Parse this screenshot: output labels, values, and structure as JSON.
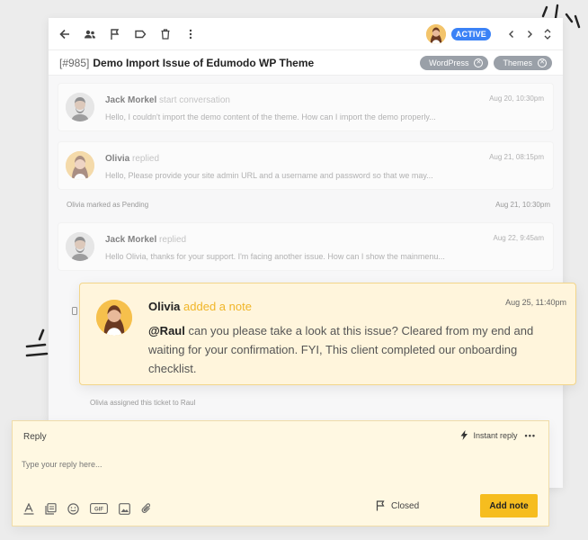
{
  "colors": {
    "accent": "#f6bd1f",
    "status_badge": "#3b82f6",
    "tag_bg": "#9aa0a8",
    "note_bg": "#fff5dc",
    "note_action": "#f0b528"
  },
  "toolbar": {
    "icons": [
      "back-arrow-icon",
      "people-icon",
      "flag-icon",
      "label-icon",
      "trash-icon",
      "more-vertical-icon"
    ],
    "status": "ACTIVE"
  },
  "ticket": {
    "id": "[#985]",
    "title": "Demo Import Issue of Edumodo WP Theme",
    "tags": [
      "WordPress",
      "Themes"
    ]
  },
  "thread": [
    {
      "name": "Jack Morkel",
      "action": "start conversation",
      "time": "Aug 20, 10:30pm",
      "text": "Hello, I couldn't import the demo content of the theme. How can I import the demo properly..."
    },
    {
      "name": "Olivia",
      "action": "replied",
      "time": "Aug 21, 08:15pm",
      "text": "Hello, Please provide your site admin URL and a username and password so that we may..."
    },
    {
      "name": "Jack Morkel",
      "action": "replied",
      "time": "Aug 22, 9:45am",
      "text": "Hello Olivia, thanks for your support. I'm facing another issue. How can I show the mainmenu..."
    }
  ],
  "activity": {
    "pending": "Olivia marked as Pending",
    "pending_time": "Aug 21, 10:30pm",
    "assigned": "Olivia assigned this ticket to Raul"
  },
  "note": {
    "name": "Olivia",
    "action": "added a note",
    "time": "Aug 25, 11:40pm",
    "mention": "@Raul",
    "text": " can you please take a look at this issue? Cleared from my end and waiting for your confirmation. FYI, This client completed our onboarding checklist."
  },
  "reply": {
    "label": "Reply",
    "instant_label": "Instant reply",
    "more": "•••",
    "placeholder": "Type your reply here...",
    "status_label": "Closed",
    "add_note_label": "Add note",
    "format_icons": [
      "text-format-icon",
      "template-icon",
      "emoji-icon",
      "gif-icon",
      "image-icon",
      "attachment-icon"
    ]
  }
}
